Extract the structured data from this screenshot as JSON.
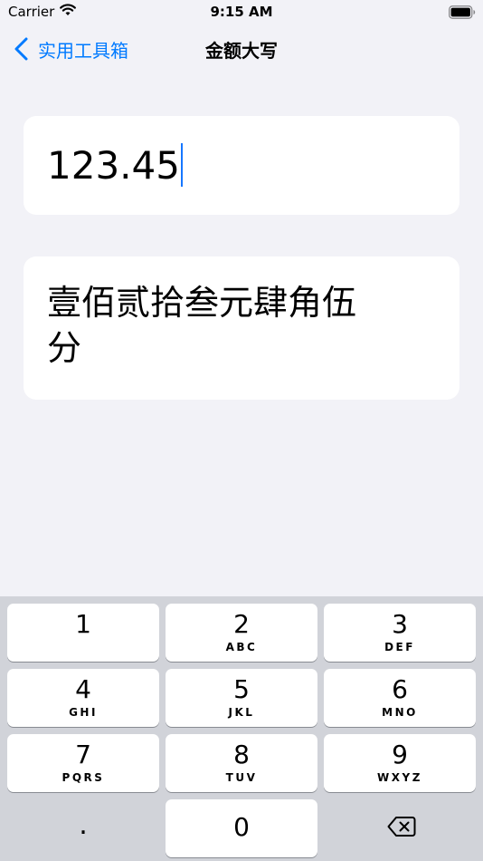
{
  "status_bar": {
    "carrier": "Carrier",
    "time": "9:15 AM",
    "wifi_icon": "wifi-icon",
    "battery_icon": "battery-icon"
  },
  "nav": {
    "back_label": "实用工具箱",
    "title": "金额大写"
  },
  "input": {
    "value": "123.45"
  },
  "result": {
    "text": "壹佰贰拾叁元肆角伍分"
  },
  "keyboard": {
    "keys": [
      {
        "digit": "1",
        "letters": ""
      },
      {
        "digit": "2",
        "letters": "ABC"
      },
      {
        "digit": "3",
        "letters": "DEF"
      },
      {
        "digit": "4",
        "letters": "GHI"
      },
      {
        "digit": "5",
        "letters": "JKL"
      },
      {
        "digit": "6",
        "letters": "MNO"
      },
      {
        "digit": "7",
        "letters": "PQRS"
      },
      {
        "digit": "8",
        "letters": "TUV"
      },
      {
        "digit": "9",
        "letters": "WXYZ"
      },
      {
        "digit": ".",
        "letters": ""
      },
      {
        "digit": "0",
        "letters": ""
      },
      {
        "icon": "delete-icon"
      }
    ]
  },
  "colors": {
    "accent": "#007aff",
    "caret": "#1677ff",
    "background": "#f2f2f7",
    "keyboard_bg": "#d1d3d9",
    "key_bg": "#ffffff"
  }
}
